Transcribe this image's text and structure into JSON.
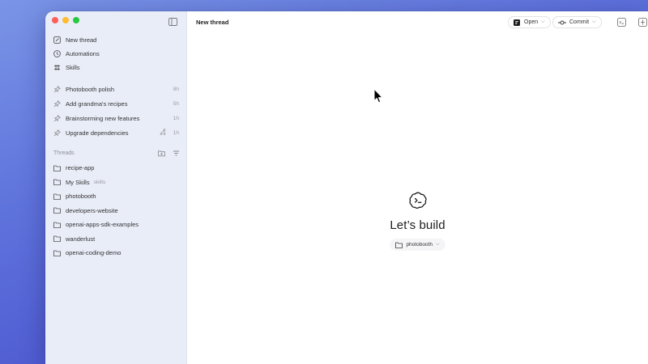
{
  "window": {
    "title": "New thread"
  },
  "sidebar": {
    "nav": [
      {
        "label": "New thread",
        "icon": "new-thread-icon"
      },
      {
        "label": "Automations",
        "icon": "clock-icon"
      },
      {
        "label": "Skills",
        "icon": "skills-icon"
      }
    ],
    "pinned": [
      {
        "label": "Photobooth polish",
        "time": "8h",
        "icon": "pin-icon"
      },
      {
        "label": "Add grandma's recipes",
        "time": "5h",
        "icon": "pin-icon"
      },
      {
        "label": "Brainstorming new features",
        "time": "1h",
        "icon": "pin-icon"
      },
      {
        "label": "Upgrade dependencies",
        "time": "1h",
        "icon": "pin-icon",
        "branch": true
      }
    ],
    "threads_title": "Threads",
    "threads": [
      {
        "label": "recipe-app",
        "sub": ""
      },
      {
        "label": "My Skills",
        "sub": "skills"
      },
      {
        "label": "photobooth",
        "sub": ""
      },
      {
        "label": "developers-website",
        "sub": ""
      },
      {
        "label": "openai-apps-sdk-examples",
        "sub": ""
      },
      {
        "label": "wanderlust",
        "sub": ""
      },
      {
        "label": "openai-coding-demo",
        "sub": ""
      }
    ]
  },
  "toolbar": {
    "open_label": "Open",
    "commit_label": "Commit"
  },
  "hero": {
    "title": "Let’s build",
    "project": "photobooth"
  },
  "colors": {
    "sidebar_bg": "#e9edf8",
    "traffic_red": "#fe5f57",
    "traffic_yellow": "#febc2e",
    "traffic_green": "#28c840"
  }
}
